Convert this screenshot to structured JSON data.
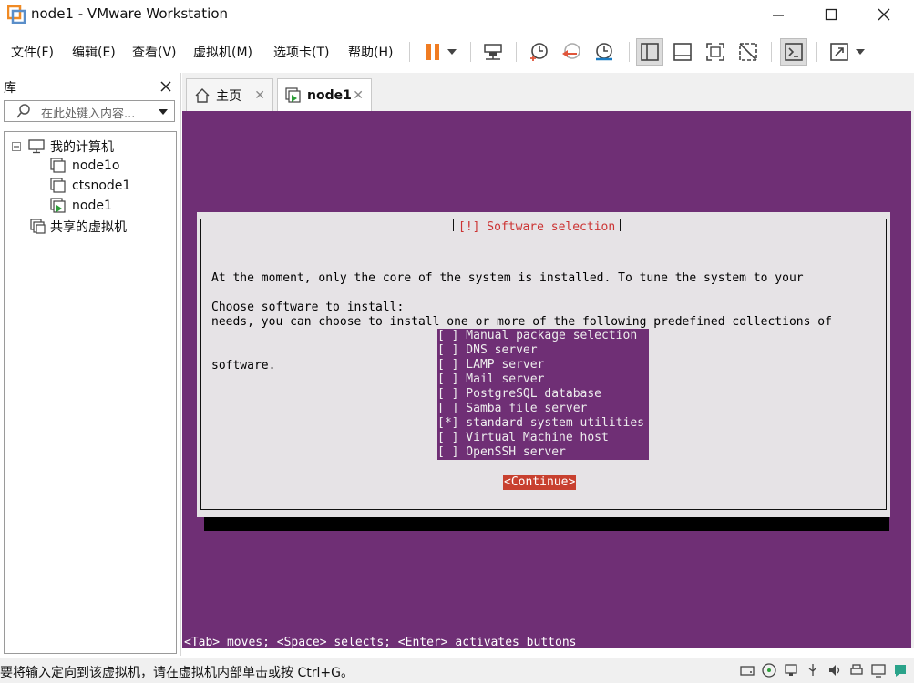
{
  "window": {
    "title": "node1 - VMware Workstation"
  },
  "menu": [
    "文件(F)",
    "编辑(E)",
    "查看(V)",
    "虚拟机(M)",
    "选项卡(T)",
    "帮助(H)"
  ],
  "library": {
    "title": "库",
    "search_placeholder": "在此处键入内容...",
    "tree": {
      "root": "我的计算机",
      "vms": [
        "node1o",
        "ctsnode1",
        "node1"
      ],
      "shared": "共享的虚拟机"
    }
  },
  "tabs": [
    {
      "label": "主页",
      "icon": "home-icon"
    },
    {
      "label": "node1",
      "icon": "vm-running-icon"
    }
  ],
  "installer": {
    "title": "[!] Software selection",
    "intro_lines": [
      "At the moment, only the core of the system is installed. To tune the system to your",
      "needs, you can choose to install one or more of the following predefined collections of",
      "software."
    ],
    "choose_label": "Choose software to install:",
    "packages": [
      "[ ] Manual package selection",
      "[ ] DNS server",
      "[ ] LAMP server",
      "[ ] Mail server",
      "[ ] PostgreSQL database",
      "[ ] Samba file server",
      "[*] standard system utilities",
      "[ ] Virtual Machine host",
      "[ ] OpenSSH server"
    ],
    "continue_label": "<Continue>",
    "hint": "<Tab> moves; <Space> selects; <Enter> activates buttons"
  },
  "status": {
    "text": "要将输入定向到该虚拟机，请在虚拟机内部单击或按 Ctrl+G。"
  },
  "colors": {
    "console_bg": "#6f2f75",
    "dialog_bg": "#e6e3e6",
    "button_red": "#c8402f",
    "title_red": "#cc3333",
    "pause_orange": "#f07c22"
  }
}
